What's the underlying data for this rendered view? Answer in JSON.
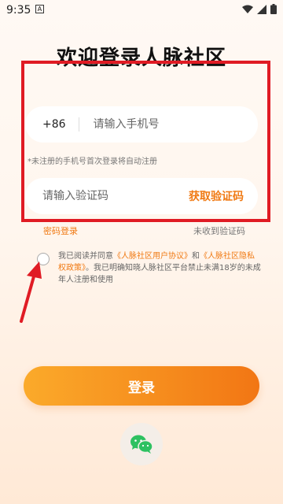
{
  "status_bar": {
    "time": "9:35",
    "notification_glyph": "A"
  },
  "page": {
    "title": "欢迎登录人脉社区"
  },
  "phone": {
    "country_code": "+86",
    "placeholder": "请输入手机号"
  },
  "hint": "*未注册的手机号首次登录将自动注册",
  "code": {
    "placeholder": "请输入验证码",
    "get_code_label": "获取验证码"
  },
  "links": {
    "password_login": "密码登录",
    "no_code": "未收到验证码"
  },
  "agreement": {
    "text1": "我已阅读并同意",
    "link1": "《人脉社区用户协议》",
    "text2": "和",
    "link2": "《人脉社区隐私权政策》",
    "text3": "。我已明确知晓人脉社区平台禁止未满18岁的未成年人注册和使用"
  },
  "login_button": "登录",
  "colors": {
    "accent": "#f07a14",
    "highlight_box": "#e01b24"
  },
  "icons": {
    "social_login": "wechat-icon"
  }
}
